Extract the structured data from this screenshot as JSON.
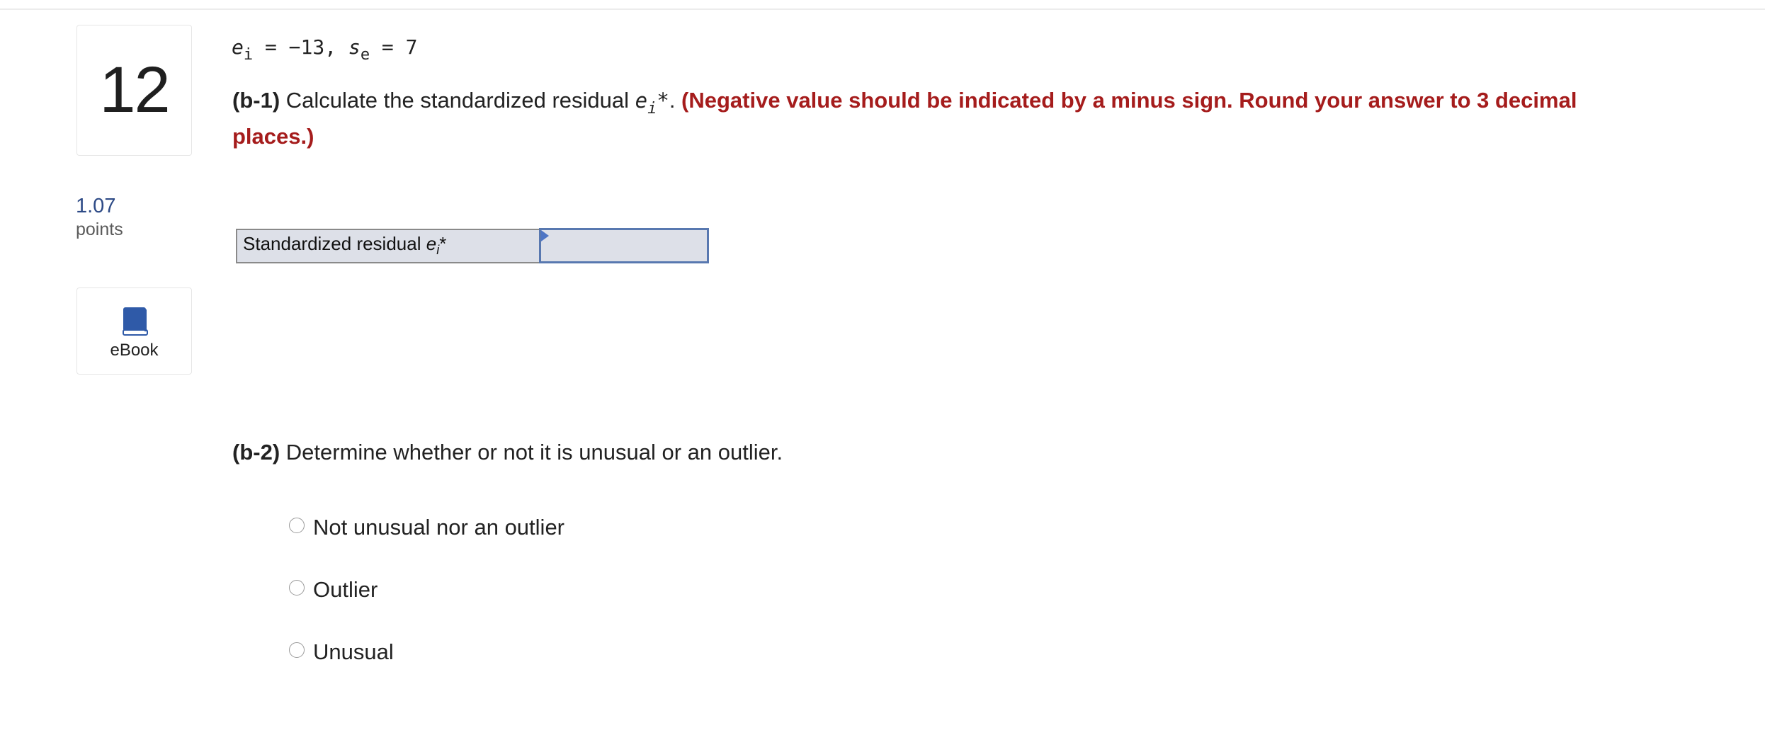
{
  "question": {
    "number": "12",
    "points_value": "1.07",
    "points_label": "points"
  },
  "ebook": {
    "label": "eBook",
    "icon": "book-icon",
    "color": "#2f5aa8"
  },
  "formula": {
    "e_var": "e",
    "e_sub": "i",
    "e_value": " = −13, ",
    "s_var": "s",
    "s_sub": "e",
    "s_value": " = 7"
  },
  "part_b1": {
    "tag": "(b-1)",
    "text": " Calculate the standardized residual ",
    "var": "e",
    "var_sub": "i",
    "var_suffix": "*",
    "period": ". ",
    "instruction": "(Negative value should be indicated by a minus sign. Round your answer to 3 decimal places.)",
    "instruction_color": "#a51c1c"
  },
  "answer_table": {
    "label_text": "Standardized residual ",
    "label_var": "e",
    "label_sub": "i",
    "label_suffix": "*",
    "input_value": ""
  },
  "part_b2": {
    "tag": "(b-2)",
    "text": " Determine whether or not it is unusual or an outlier.",
    "options": [
      {
        "label": "Not unusual nor an outlier"
      },
      {
        "label": "Outlier"
      },
      {
        "label": "Unusual"
      }
    ]
  }
}
